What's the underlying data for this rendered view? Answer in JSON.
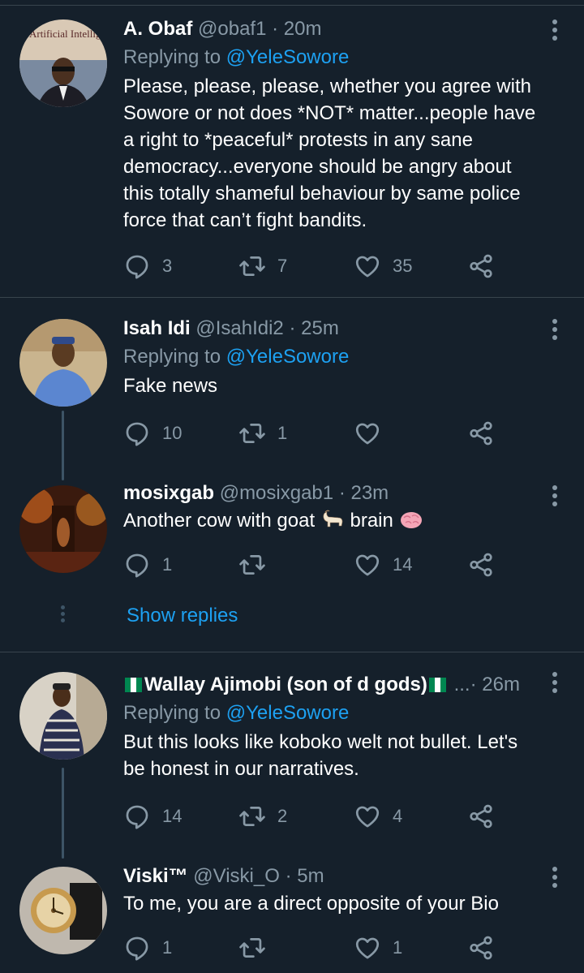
{
  "tweets": [
    {
      "name": "A. Obaf",
      "handle": "@obaf1",
      "sep": "·",
      "time": "20m",
      "replying_prefix": "Replying to ",
      "replying_to": "@YeleSowore",
      "text": "Please, please, please, whether you agree with Sowore or not does *NOT* matter...people have a right to *peaceful* protests in any sane democracy...everyone should be angry about this totally shameful behaviour by same police force that can’t fight bandits.",
      "avatar_caption": "Artificial Intelligence",
      "replies": "3",
      "retweets": "7",
      "likes": "35"
    },
    {
      "name": "Isah Idi",
      "handle": "@IsahIdi2",
      "sep": "·",
      "time": "25m",
      "replying_prefix": "Replying to ",
      "replying_to": "@YeleSowore",
      "text": "Fake news",
      "replies": "10",
      "retweets": "1",
      "likes": ""
    },
    {
      "name": "mosixgab",
      "handle": "@mosixgab1",
      "sep": "·",
      "time": "23m",
      "text_a": "Another cow with goat",
      "text_b": "brain",
      "replies": "1",
      "retweets": "",
      "likes": "14"
    },
    {
      "name": "Wallay Ajimobi (son of d gods)",
      "handle": "...",
      "sep": "·",
      "time": "26m",
      "replying_prefix": "Replying to ",
      "replying_to": "@YeleSowore",
      "text": "But this looks like koboko welt not bullet. Let's be honest in our narratives.",
      "replies": "14",
      "retweets": "2",
      "likes": "4"
    },
    {
      "name": "Viski™",
      "handle": "@Viski_O",
      "sep": "·",
      "time": "5m",
      "text": "To me, you are a direct opposite of your Bio",
      "replies": "1",
      "retweets": "",
      "likes": "1"
    }
  ],
  "show_replies": "Show replies",
  "icons": {
    "reply": "reply-icon",
    "retweet": "retweet-icon",
    "like": "like-icon",
    "share": "share-icon",
    "more": "more-options-icon"
  },
  "colors": {
    "background": "#15202b",
    "text": "#ffffff",
    "muted": "#8899a6",
    "link": "#1da1f2",
    "divider": "#38444d"
  }
}
